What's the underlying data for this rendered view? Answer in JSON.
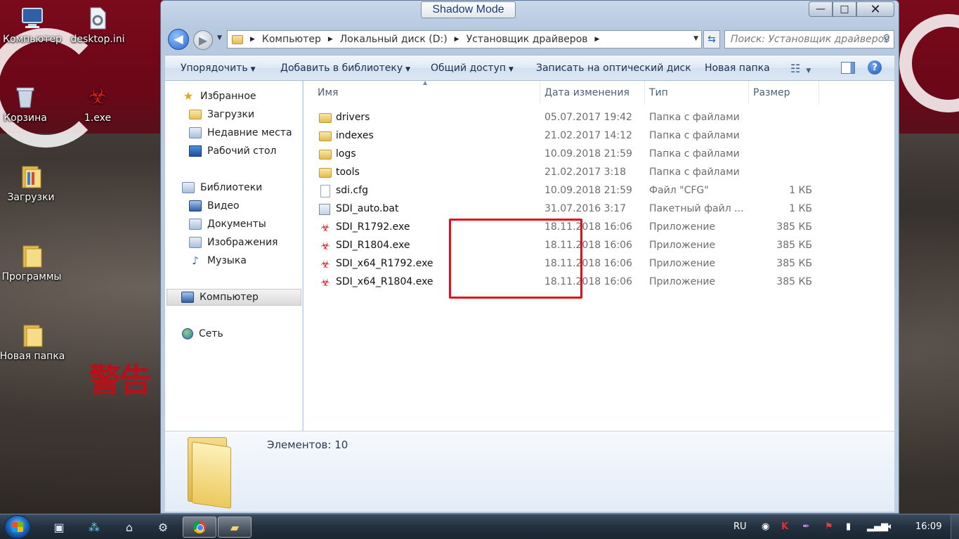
{
  "desktop": {
    "icons": [
      {
        "label": "Компьютер",
        "icon": "computer-icon"
      },
      {
        "label": "desktop.ini",
        "icon": "settings-file-icon"
      },
      {
        "label": "Корзина",
        "icon": "recycle-bin-icon"
      },
      {
        "label": "1.exe",
        "icon": "biohazard-icon"
      },
      {
        "label": "Загрузки",
        "icon": "folder-icon"
      },
      {
        "label": "Программы",
        "icon": "folder-icon"
      },
      {
        "label": "Новая папка",
        "icon": "folder-icon"
      }
    ],
    "wallpaper_text": "警告"
  },
  "window": {
    "shadow_mode_label": "Shadow Mode",
    "controls": {
      "minimize": "—",
      "maximize": "□",
      "close": "✕"
    },
    "breadcrumb": [
      "Компьютер",
      "Локальный диск (D:)",
      "Установщик драйверов"
    ],
    "search_placeholder": "Поиск: Установщик драйверов",
    "toolbar": {
      "organize": "Упорядочить",
      "add_to_library": "Добавить в библиотеку",
      "share": "Общий доступ",
      "burn": "Записать на оптический диск",
      "new_folder": "Новая папка",
      "help": "?"
    },
    "navpane": {
      "favorites": "Избранное",
      "downloads": "Загрузки",
      "recent": "Недавние места",
      "desktop": "Рабочий стол",
      "libraries": "Библиотеки",
      "video": "Видео",
      "documents": "Документы",
      "pictures": "Изображения",
      "music": "Музыка",
      "computer": "Компьютер",
      "network": "Сеть"
    },
    "columns": {
      "name": "Имя",
      "date": "Дата изменения",
      "type": "Тип",
      "size": "Размер"
    },
    "files": [
      {
        "name": "drivers",
        "date": "05.07.2017 19:42",
        "type": "Папка с файлами",
        "size": "",
        "icon": "folder-icon"
      },
      {
        "name": "indexes",
        "date": "21.02.2017 14:12",
        "type": "Папка с файлами",
        "size": "",
        "icon": "folder-icon"
      },
      {
        "name": "logs",
        "date": "10.09.2018 21:59",
        "type": "Папка с файлами",
        "size": "",
        "icon": "folder-icon"
      },
      {
        "name": "tools",
        "date": "21.02.2017 3:18",
        "type": "Папка с файлами",
        "size": "",
        "icon": "folder-icon"
      },
      {
        "name": "sdi.cfg",
        "date": "10.09.2018 21:59",
        "type": "Файл \"CFG\"",
        "size": "1 КБ",
        "icon": "document-icon"
      },
      {
        "name": "SDI_auto.bat",
        "date": "31.07.2016 3:17",
        "type": "Пакетный файл ...",
        "size": "1 КБ",
        "icon": "batch-file-icon"
      },
      {
        "name": "SDI_R1792.exe",
        "date": "18.11.2018 16:06",
        "type": "Приложение",
        "size": "385 КБ",
        "icon": "biohazard-icon"
      },
      {
        "name": "SDI_R1804.exe",
        "date": "18.11.2018 16:06",
        "type": "Приложение",
        "size": "385 КБ",
        "icon": "biohazard-icon"
      },
      {
        "name": "SDI_x64_R1792.exe",
        "date": "18.11.2018 16:06",
        "type": "Приложение",
        "size": "385 КБ",
        "icon": "biohazard-icon"
      },
      {
        "name": "SDI_x64_R1804.exe",
        "date": "18.11.2018 16:06",
        "type": "Приложение",
        "size": "385 КБ",
        "icon": "biohazard-icon"
      }
    ],
    "details": {
      "count_text": "Элементов: 10"
    }
  },
  "taskbar": {
    "language": "RU",
    "clock": "16:09"
  },
  "colors": {
    "highlight": "#e3101a",
    "wallpaper_red": "#7a0a1c",
    "hazard_red": "#d2141e"
  }
}
